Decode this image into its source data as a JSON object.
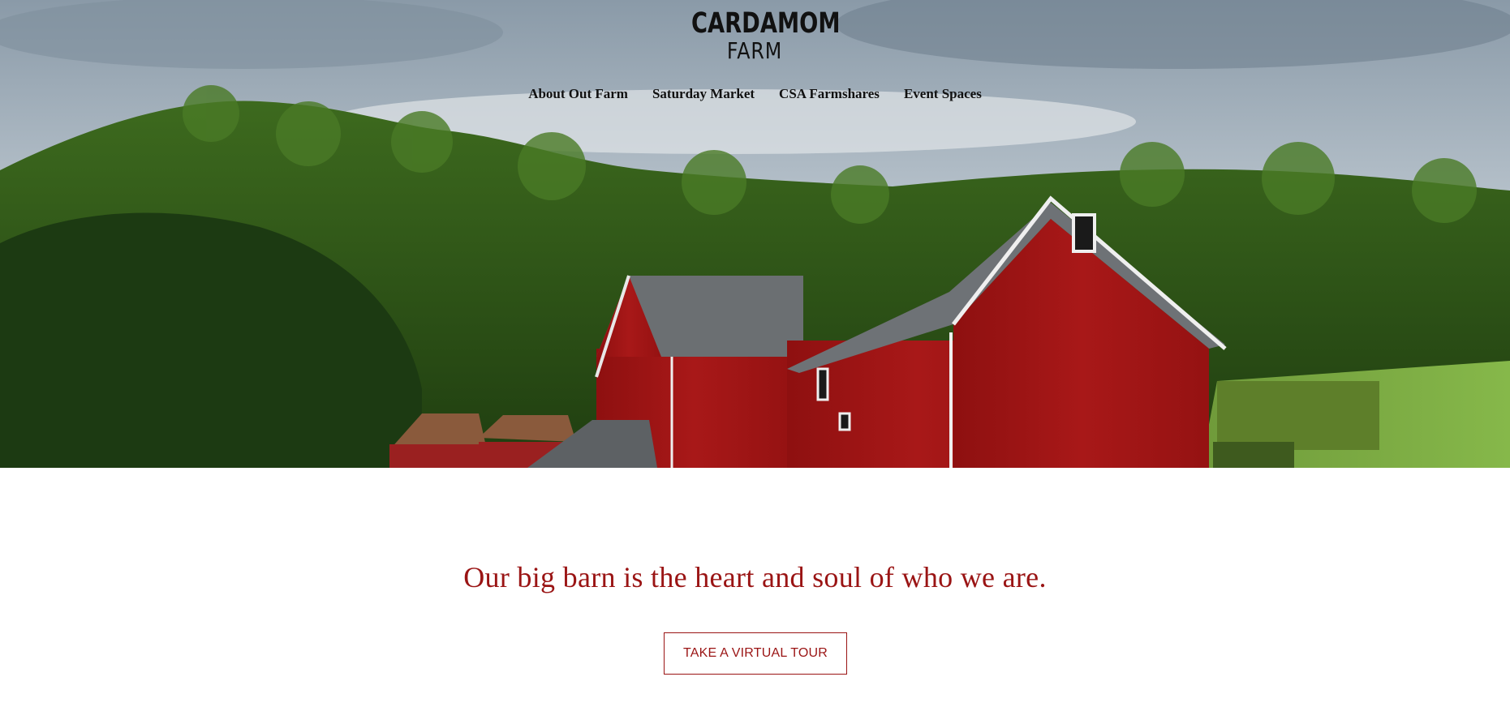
{
  "header": {
    "logo_line1": "CARDAMOM",
    "logo_line2": "FARM"
  },
  "nav": {
    "items": [
      {
        "label": "About Out Farm"
      },
      {
        "label": "Saturday Market"
      },
      {
        "label": "CSA Farmshares"
      },
      {
        "label": "Event Spaces"
      }
    ]
  },
  "main": {
    "tagline": "Our big barn is the heart and soul of who we are.",
    "cta_label": "TAKE A VIRTUAL TOUR"
  },
  "colors": {
    "accent": "#9a1414",
    "text": "#111111",
    "background": "#ffffff"
  }
}
